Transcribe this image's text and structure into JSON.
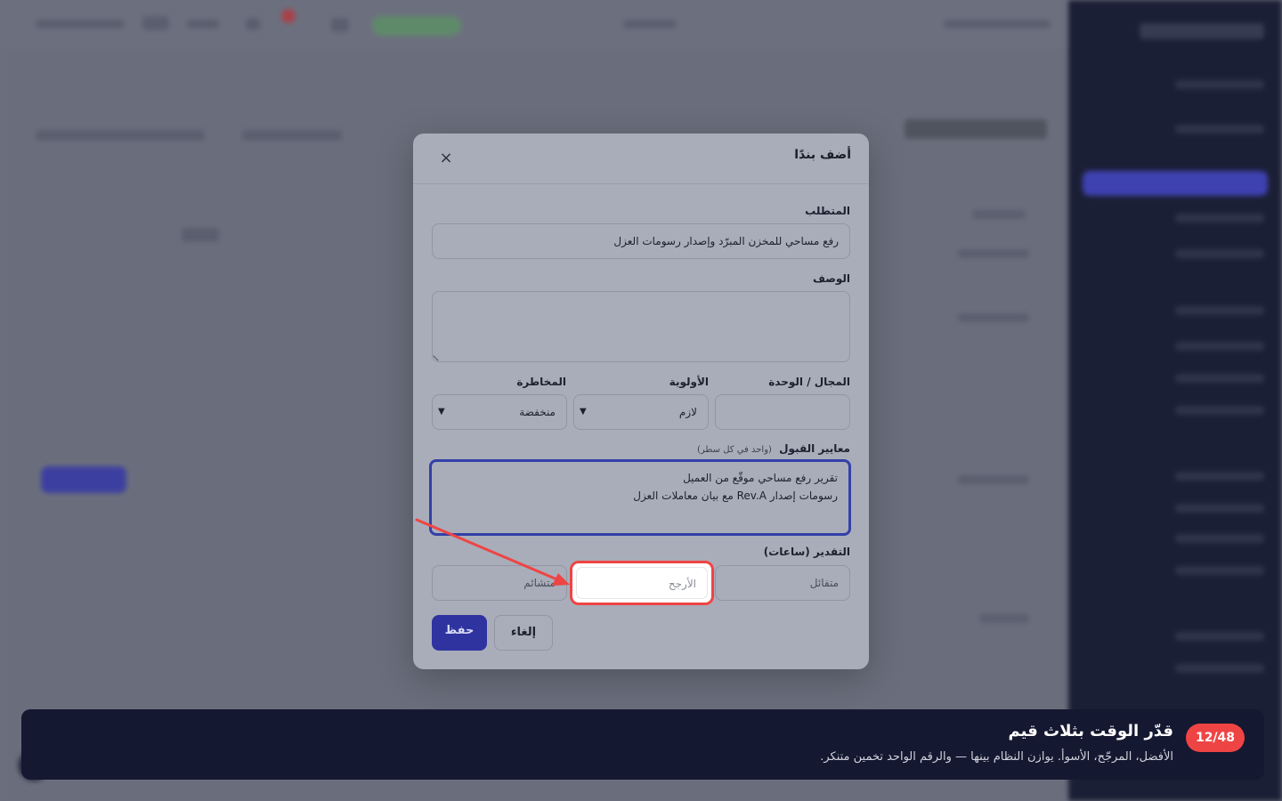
{
  "modal": {
    "title": "أضف بندًا",
    "close_icon": "×",
    "requirement_label": "المتطلب",
    "requirement_value": "رفع مساحي للمخزن المبرّد وإصدار رسومات العزل",
    "description_label": "الوصف",
    "description_value": "",
    "domain_label": "المجال / الوحدة",
    "domain_value": "",
    "priority_label": "الأولوية",
    "priority_value": "لازم",
    "risk_label": "المخاطرة",
    "risk_value": "منخفضة",
    "criteria_label": "معايير القبول",
    "criteria_hint": "(واحد في كل سطر)",
    "criteria_lines": [
      "تقرير رفع مساحي موقّع من العميل",
      "رسومات إصدار Rev.A مع بيان معاملات العزل"
    ],
    "estimate_label": "التقدير (ساعات)",
    "optimistic_placeholder": "متفائل",
    "likely_placeholder": "الأرجح",
    "pessimistic_placeholder": "متشائم",
    "save_label": "حفظ",
    "cancel_label": "إلغاء"
  },
  "banner": {
    "step": "12/48",
    "title": "قدّر الوقت بثلاث قيم",
    "text": "الأفضل، المرجّح، الأسوأ. يوازن النظام بينها — والرقم الواحد تخمين متنكر."
  },
  "colors": {
    "accent": "#2e33a0",
    "highlight": "#ef4444",
    "banner_bg": "#141830",
    "focus_border": "#3340a8"
  },
  "icons": {
    "close": "close-icon",
    "chevron": "chevron-down-icon",
    "arrow": "pointer-arrow-icon"
  }
}
